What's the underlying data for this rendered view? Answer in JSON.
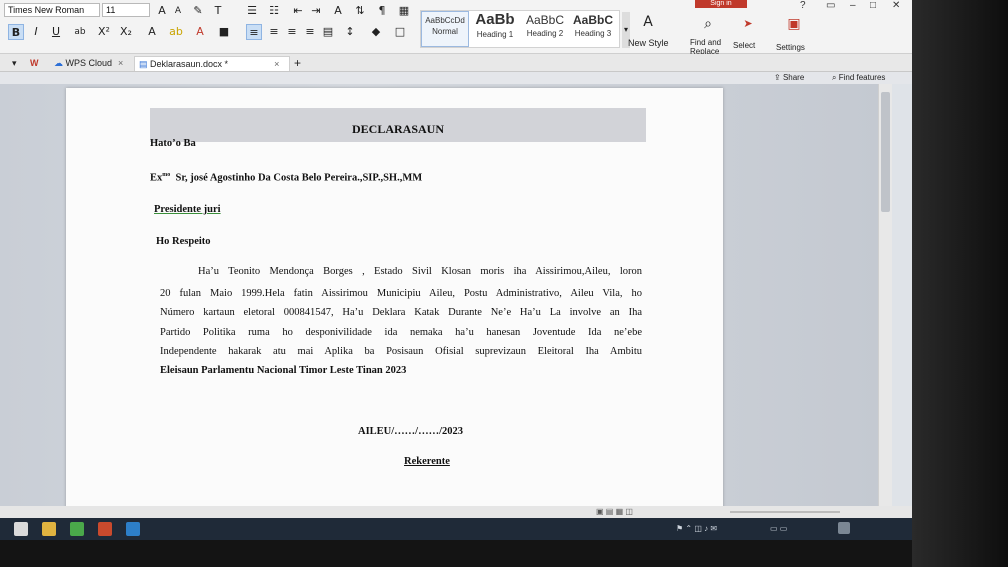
{
  "ribbon": {
    "font_name": "Times New Roman",
    "font_size": "11",
    "styles": [
      {
        "preview": "AaBbCcDd",
        "label": "Normal"
      },
      {
        "preview": "AaBb",
        "label": "Heading 1"
      },
      {
        "preview": "AaBbC",
        "label": "Heading 2"
      },
      {
        "preview": "AaBbC",
        "label": "Heading 3"
      }
    ],
    "new_style": "New Style",
    "find_replace": "Find and Replace",
    "select": "Select",
    "settings": "Settings",
    "sign_in": "Sign in"
  },
  "tabs": [
    {
      "label": "WPS Cloud"
    },
    {
      "label": "Deklarasaun.docx *"
    }
  ],
  "share": "Share",
  "find_features": "Find features",
  "document": {
    "title": "DECLARASAUN",
    "to": "Hato’o Ba",
    "addressee_prefix": "Ex",
    "addressee_suffix": "mo",
    "addressee": "Sr, josé Agostinho Da Costa Belo Pereira.,SIP.,SH.,MM",
    "position": "Presidente juri",
    "greeting": "Ho Respeito",
    "body_lines": [
      "Ha’u Teonito Mendonça Borges , Estado Sivil Klosan moris iha Aissirimou,Aileu, loron",
      "20 fulan Maio 1999.Hela fatin Aissirimou Municipiu Aileu, Postu Administrativo, Aileu Vila, ho",
      "Número kartaun eletoral 000841547, Ha’u Deklara Katak Durante Ne’e Ha’u La involve an Iha",
      "Partido Politika ruma ho desponivilidade ida nemaka ha’u hanesan Joventude Ida ne’ebe",
      "Independente hakarak atu mai Aplika ba Posisaun Ofisial suprevizaun Eleitoral Iha Ambitu",
      "Eleisaun Parlamentu Nacional Timor Leste Tinan 2023"
    ],
    "place_date": "AILEU/……/……/2023",
    "signature": "Rekerente"
  }
}
